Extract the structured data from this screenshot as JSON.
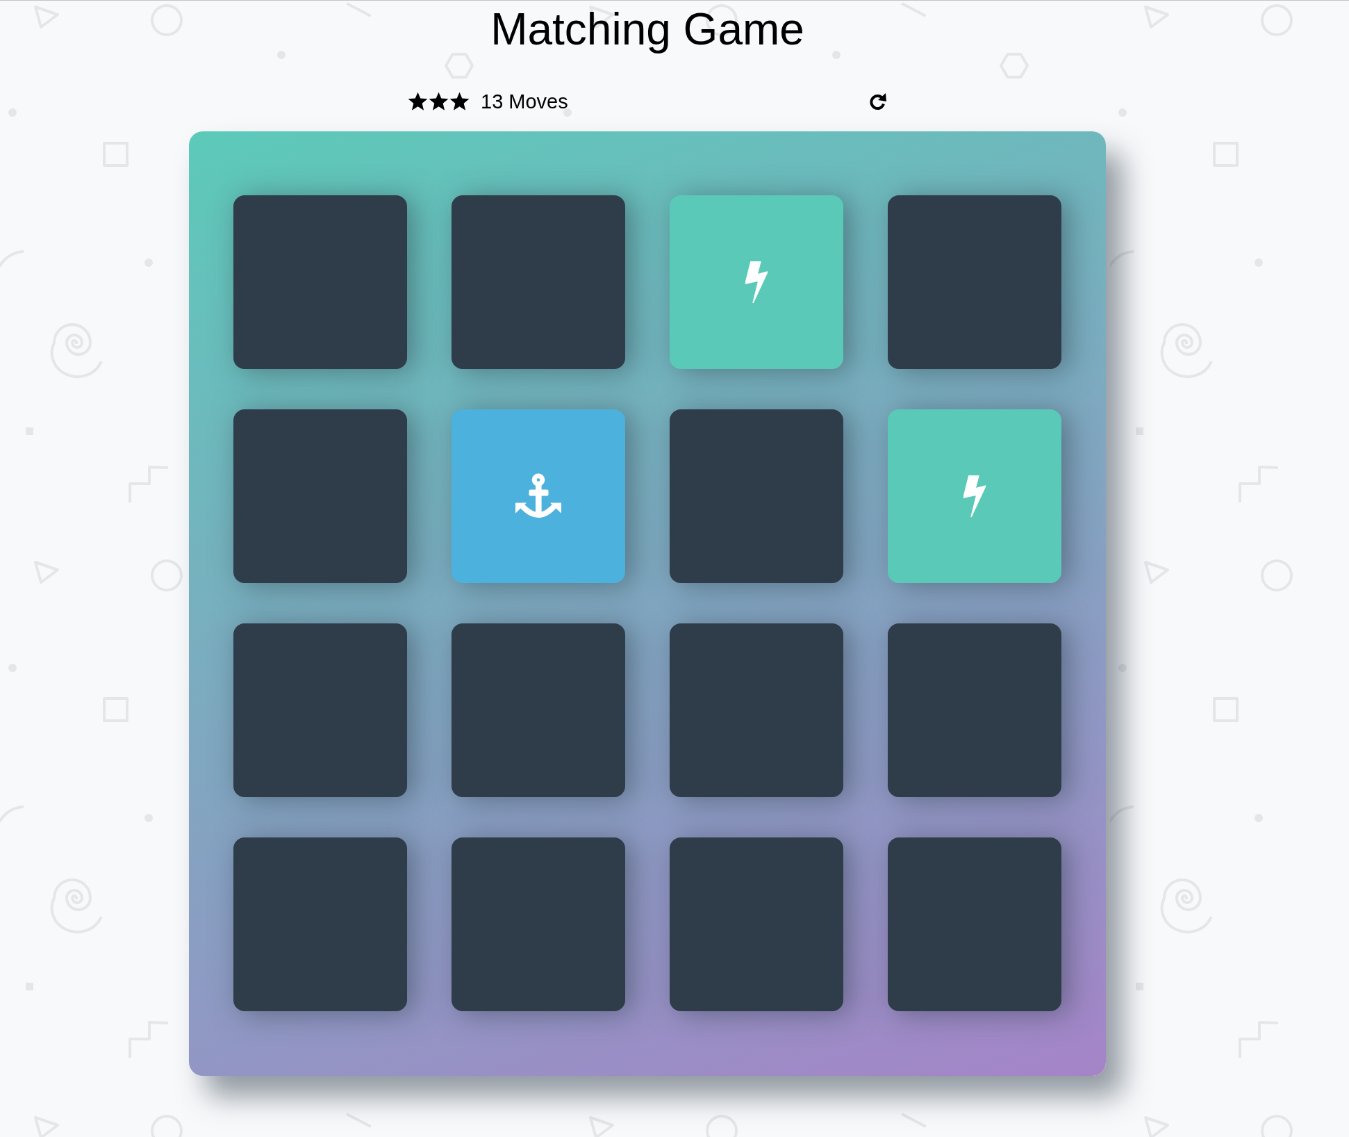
{
  "title": "Matching Game",
  "score": {
    "stars": 3,
    "moves": "13 Moves"
  },
  "deck": {
    "cards": [
      {
        "face_up": false
      },
      {
        "face_up": false
      },
      {
        "face_up": true,
        "matched": true,
        "kind": "bolt"
      },
      {
        "face_up": false
      },
      {
        "face_up": false
      },
      {
        "face_up": true,
        "matched": false,
        "kind": "anchor"
      },
      {
        "face_up": false
      },
      {
        "face_up": true,
        "matched": true,
        "kind": "bolt"
      },
      {
        "face_up": false
      },
      {
        "face_up": false
      },
      {
        "face_up": false
      },
      {
        "face_up": false
      },
      {
        "face_up": false
      },
      {
        "face_up": false
      },
      {
        "face_up": false
      },
      {
        "face_up": false
      }
    ]
  }
}
